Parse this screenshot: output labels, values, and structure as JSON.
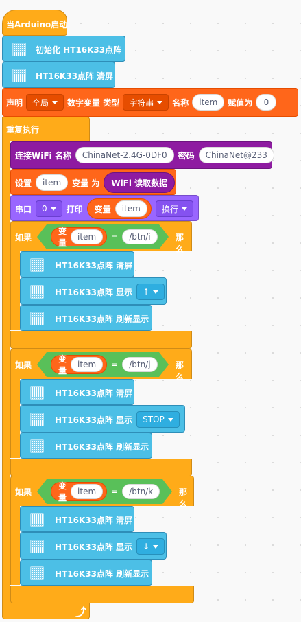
{
  "hat": {
    "label": "当Arduino启动"
  },
  "init_block": {
    "label": "初始化 HT16K33点阵"
  },
  "clear_block_top": {
    "label": "HT16K33点阵 清屏"
  },
  "declare": {
    "label": "声明",
    "scope": "全局",
    "var_label": "数字变量 类型",
    "type": "字符串",
    "name_label": "名称",
    "name": "item",
    "assign_label": "赋值为",
    "value": "0"
  },
  "forever": {
    "label": "重复执行"
  },
  "wifi": {
    "label": "连接WiFi 名称",
    "ssid": "ChinaNet-2.4G-0DF0",
    "pwd_label": "密码",
    "password": "ChinaNet@233"
  },
  "set_var": {
    "label": "设置",
    "var": "item",
    "to_label": "变量 为",
    "reporter": "WiFi 读取数据"
  },
  "serial": {
    "label": "串口",
    "port": "0",
    "print_label": "打印",
    "var_label": "变量",
    "var": "item",
    "newline": "换行"
  },
  "ifs": [
    {
      "if_label": "如果",
      "var_label": "变量",
      "var": "item",
      "op": "=",
      "value": "/btn/i",
      "then_label": "那么",
      "clear": "HT16K33点阵 清屏",
      "show": "HT16K33点阵 显示",
      "show_value": "↑",
      "refresh": "HT16K33点阵 刷新显示"
    },
    {
      "if_label": "如果",
      "var_label": "变量",
      "var": "item",
      "op": "=",
      "value": "/btn/j",
      "then_label": "那么",
      "clear": "HT16K33点阵 清屏",
      "show": "HT16K33点阵 显示",
      "show_value": "STOP",
      "refresh": "HT16K33点阵 刷新显示"
    },
    {
      "if_label": "如果",
      "var_label": "变量",
      "var": "item",
      "op": "=",
      "value": "/btn/k",
      "then_label": "那么",
      "clear": "HT16K33点阵 清屏",
      "show": "HT16K33点阵 显示",
      "show_value": "↓",
      "refresh": "HT16K33点阵 刷新显示"
    }
  ],
  "colors": {
    "control": "#ffab19",
    "display": "#4cbfe6",
    "variable": "#ff661a",
    "serial": "#9966ff",
    "wifi": "#8e1ba1",
    "operator": "#59c059"
  },
  "icons": {
    "loop_arrow": "loop-arrow-icon",
    "led_matrix": "led-matrix-icon"
  }
}
